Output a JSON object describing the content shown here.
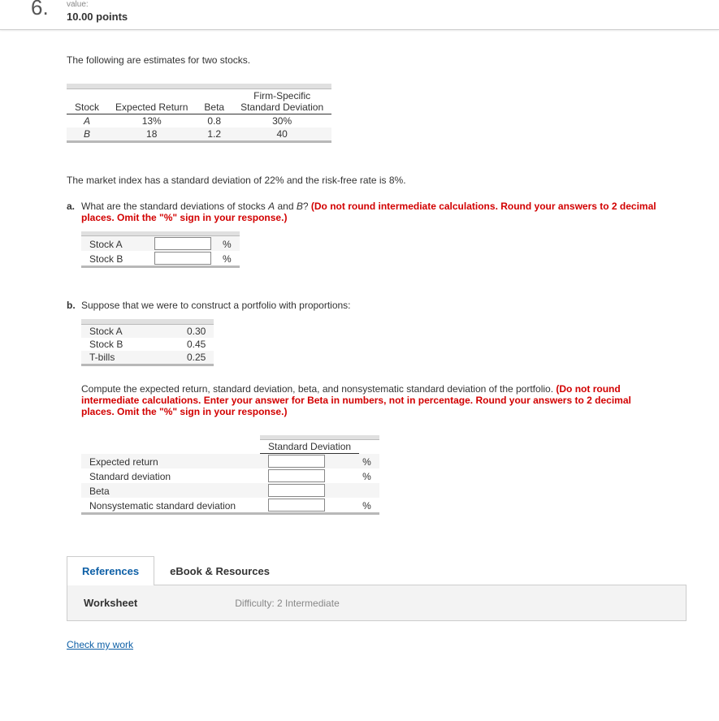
{
  "header": {
    "question_number": "6.",
    "value_label": "value:",
    "points": "10.00 points"
  },
  "intro": "The following are estimates for two stocks.",
  "stock_table": {
    "headers": {
      "c0": "Stock",
      "c1": "Expected Return",
      "c2": "Beta",
      "c3": "Firm-Specific\nStandard Deviation"
    },
    "rows": [
      {
        "stock": "A",
        "er": "13%",
        "beta": "0.8",
        "fssd": "30%"
      },
      {
        "stock": "B",
        "er": "18",
        "beta": "1.2",
        "fssd": "40"
      }
    ]
  },
  "mkt_text": "The market index has a standard deviation of 22% and the risk-free rate is 8%.",
  "part_a": {
    "letter": "a.",
    "q_black": "What are the standard deviations of stocks ",
    "q_ital1": "A",
    "q_mid": " and ",
    "q_ital2": "B",
    "q_after": "? ",
    "q_red": "(Do not round intermediate calculations. Round your answers to 2 decimal places. Omit the \"%\" sign in your response.)",
    "rows": [
      {
        "label": "Stock A",
        "unit": "%"
      },
      {
        "label": "Stock B",
        "unit": "%"
      }
    ]
  },
  "part_b": {
    "letter": "b.",
    "q": "Suppose that we were to construct a portfolio with proportions:",
    "props": [
      {
        "label": "Stock A",
        "val": "0.30"
      },
      {
        "label": "Stock B",
        "val": "0.45"
      },
      {
        "label": "T-bills",
        "val": "0.25"
      }
    ],
    "compute_black": "Compute the expected return, standard deviation, beta, and nonsystematic standard deviation of the portfolio. ",
    "compute_red": "(Do not round intermediate calculations. Enter your answer for Beta in numbers, not in percentage. Round your answers to 2 decimal places. Omit the \"%\" sign in your response.)",
    "ans_header": "Standard Deviation",
    "ans_rows": [
      {
        "label": "Expected return",
        "unit": "%"
      },
      {
        "label": "Standard deviation",
        "unit": "%"
      },
      {
        "label": "Beta",
        "unit": ""
      },
      {
        "label": "Nonsystematic standard deviation",
        "unit": "%"
      }
    ]
  },
  "tabs": {
    "ref": "References",
    "ebook": "eBook & Resources",
    "worksheet": "Worksheet",
    "difficulty": "Difficulty: 2 Intermediate"
  },
  "check": "Check my work"
}
